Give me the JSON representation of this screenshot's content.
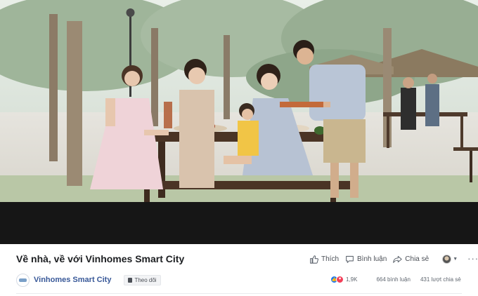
{
  "post": {
    "title": "Về nhà, về với Vinhomes Smart City",
    "page_name": "Vinhomes Smart City",
    "follow_label": "Theo dõi"
  },
  "actions": {
    "like_label": "Thích",
    "comment_label": "Bình luận",
    "share_label": "Chia sẻ",
    "more": "···"
  },
  "stats": {
    "reactions": "1,9K",
    "comments": "664 bình luận",
    "shares": "431 lượt chia sẻ"
  },
  "colors": {
    "link_blue": "#385898",
    "like_blue": "#1877f2",
    "love_red": "#f33e58",
    "video_bar": "#161616"
  }
}
